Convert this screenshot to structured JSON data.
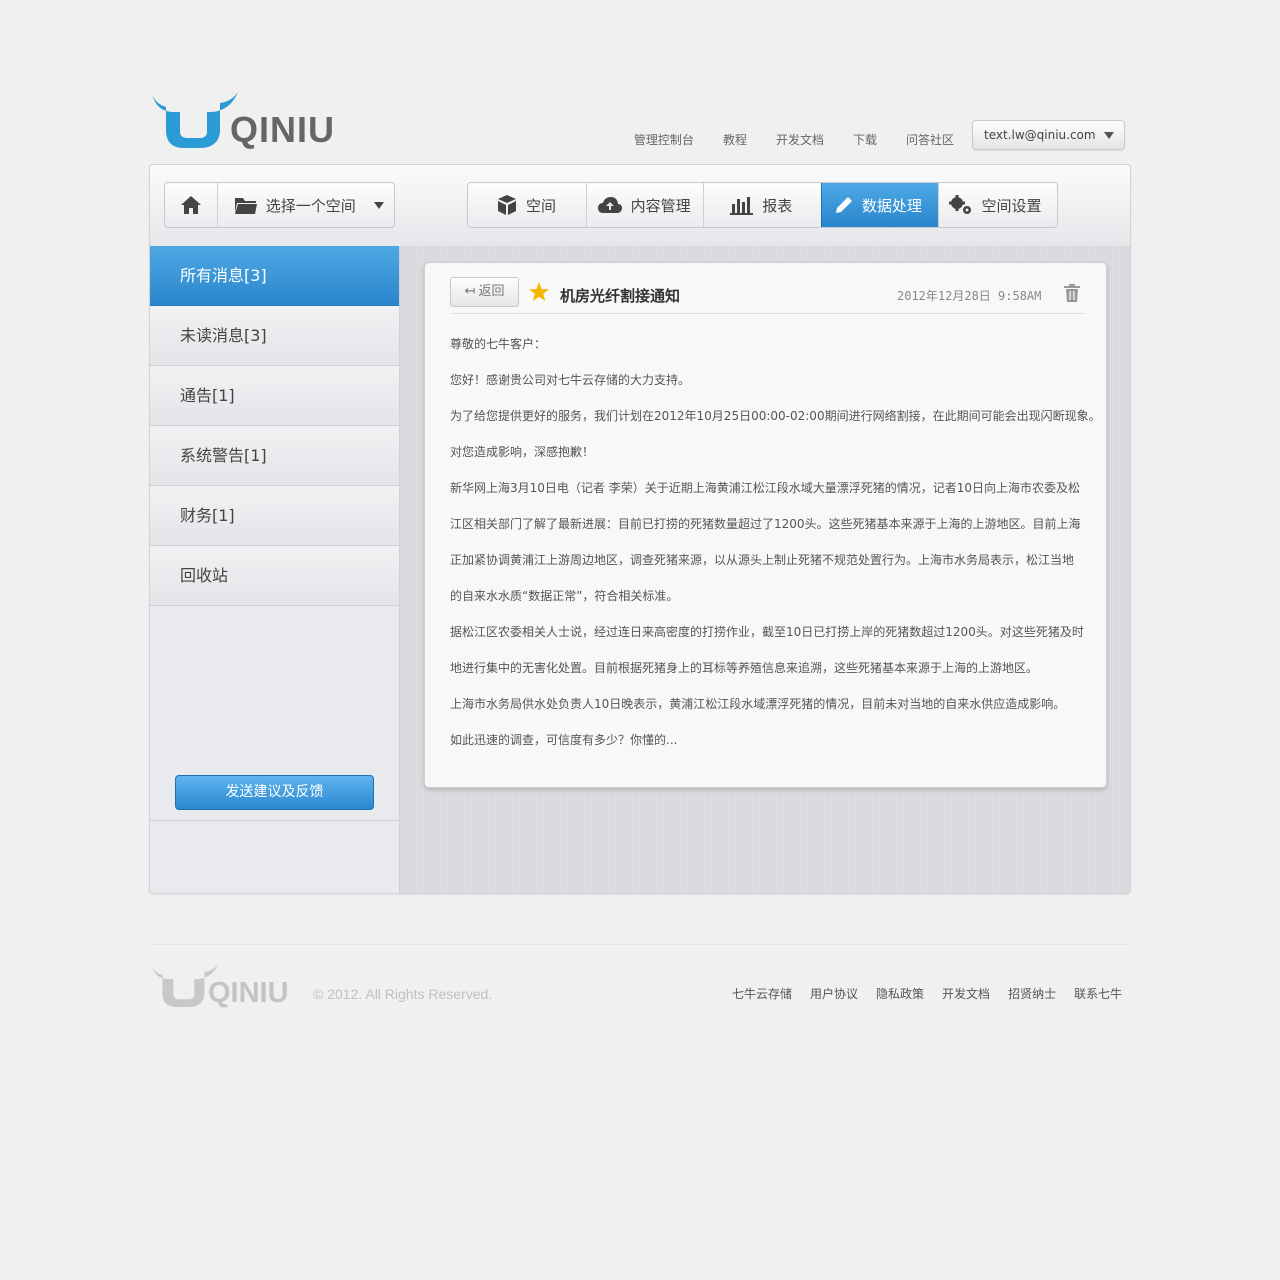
{
  "logo_text": "QINIU",
  "colors": {
    "brand_blue": "#2a86cc",
    "star": "#f5b800"
  },
  "header": {
    "links": [
      "管理控制台",
      "教程",
      "开发文档",
      "下载",
      "问答社区"
    ],
    "account": "text.lw@qiniu.com"
  },
  "toolbar": {
    "space_select": "选择一个空间",
    "tabs": [
      "空间",
      "内容管理",
      "报表",
      "数据处理",
      "空间设置"
    ],
    "active_tab": "数据处理"
  },
  "sidebar": {
    "items": [
      "所有消息[3]",
      "未读消息[3]",
      "通告[1]",
      "系统警告[1]",
      "财务[1]",
      "回收站"
    ],
    "feedback_button": "发送建议及反馈"
  },
  "message": {
    "back_label": "返回",
    "subject": "机房光纤割接通知",
    "date": "2012年12月28日 9:58AM",
    "starred": true,
    "body": [
      "尊敬的七牛客户：",
      "您好！感谢贵公司对七牛云存储的大力支持。",
      "为了给您提供更好的服务，我们计划在2012年10月25日00:00-02:00期间进行网络割接，在此期间可能会出现闪断现象。",
      "对您造成影响，深感抱歉！",
      "新华网上海3月10日电（记者 李荣）关于近期上海黄浦江松江段水域大量漂浮死猪的情况，记者10日向上海市农委及松",
      "江区相关部门了解了最新进展：目前已打捞的死猪数量超过了1200头。这些死猪基本来源于上海的上游地区。目前上海",
      "正加紧协调黄浦江上游周边地区，调查死猪来源，以从源头上制止死猪不规范处置行为。上海市水务局表示，松江当地",
      "的自来水水质“数据正常”，符合相关标准。",
      "据松江区农委相关人士说，经过连日来高密度的打捞作业，截至10日已打捞上岸的死猪数超过1200头。对这些死猪及时",
      "地进行集中的无害化处置。目前根据死猪身上的耳标等养殖信息来追溯，这些死猪基本来源于上海的上游地区。",
      "上海市水务局供水处负责人10日晚表示，黄浦江松江段水域漂浮死猪的情况，目前未对当地的自来水供应造成影响。",
      "如此迅速的调查，可信度有多少？你懂的..."
    ]
  },
  "footer": {
    "copyright": "© 2012. All Rights Reserved.",
    "links": [
      "七牛云存储",
      "用户协议",
      "隐私政策",
      "开发文档",
      "招贤纳士",
      "联系七牛"
    ]
  }
}
